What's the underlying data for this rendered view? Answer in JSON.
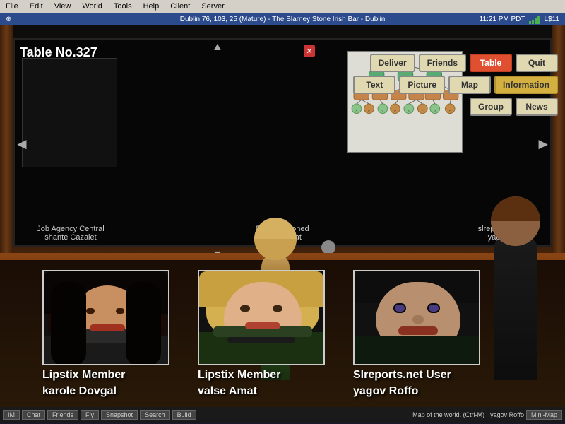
{
  "menubar": {
    "items": [
      "File",
      "Edit",
      "View",
      "World",
      "Tools",
      "Help",
      "Client",
      "Server"
    ]
  },
  "titlebar": {
    "icon": "⊕",
    "title": "Dublin 76, 103, 25 (Mature) - The Blarney Stone Irish Bar - Dublin",
    "time": "11:21 PM PDT",
    "connection": "L$11"
  },
  "table": {
    "title": "Table No.327"
  },
  "toolbar": {
    "row1": [
      {
        "label": "Deliver",
        "active": false,
        "highlight": false
      },
      {
        "label": "Friends",
        "active": false,
        "highlight": false
      },
      {
        "label": "Table",
        "active": true,
        "highlight": false
      },
      {
        "label": "Quit",
        "active": false,
        "highlight": false
      }
    ],
    "row2": [
      {
        "label": "Text",
        "active": false,
        "highlight": false
      },
      {
        "label": "Picture",
        "active": false,
        "highlight": false
      },
      {
        "label": "Map",
        "active": false,
        "highlight": false
      },
      {
        "label": "Information",
        "active": false,
        "highlight": true
      }
    ],
    "row3": [
      {
        "label": "Group",
        "active": false,
        "highlight": false
      },
      {
        "label": "News",
        "active": false,
        "highlight": false
      }
    ]
  },
  "captions": {
    "left": "Job Agency Central\nshante Cazalet",
    "center": "Blarney Stoned\nvalse Amat",
    "right": "slreports.net User\nyagov Roffo"
  },
  "characters": [
    {
      "name_line1": "Lipstix Member",
      "name_line2": "karole Dovgal",
      "position": "left"
    },
    {
      "name_line1": "Lipstix Member",
      "name_line2": "valse Amat",
      "position": "center"
    },
    {
      "name_line1": "Slreports.net User",
      "name_line2": "yagov Roffo",
      "position": "right"
    }
  ],
  "taskbar": {
    "items": [
      "IM",
      "Chat",
      "Friends",
      "Fly",
      "Snapshot",
      "Search",
      "Build",
      "Mini-Map"
    ],
    "right_text": "Map of the world. (Ctrl-M)",
    "user": "yagov Roffo"
  }
}
